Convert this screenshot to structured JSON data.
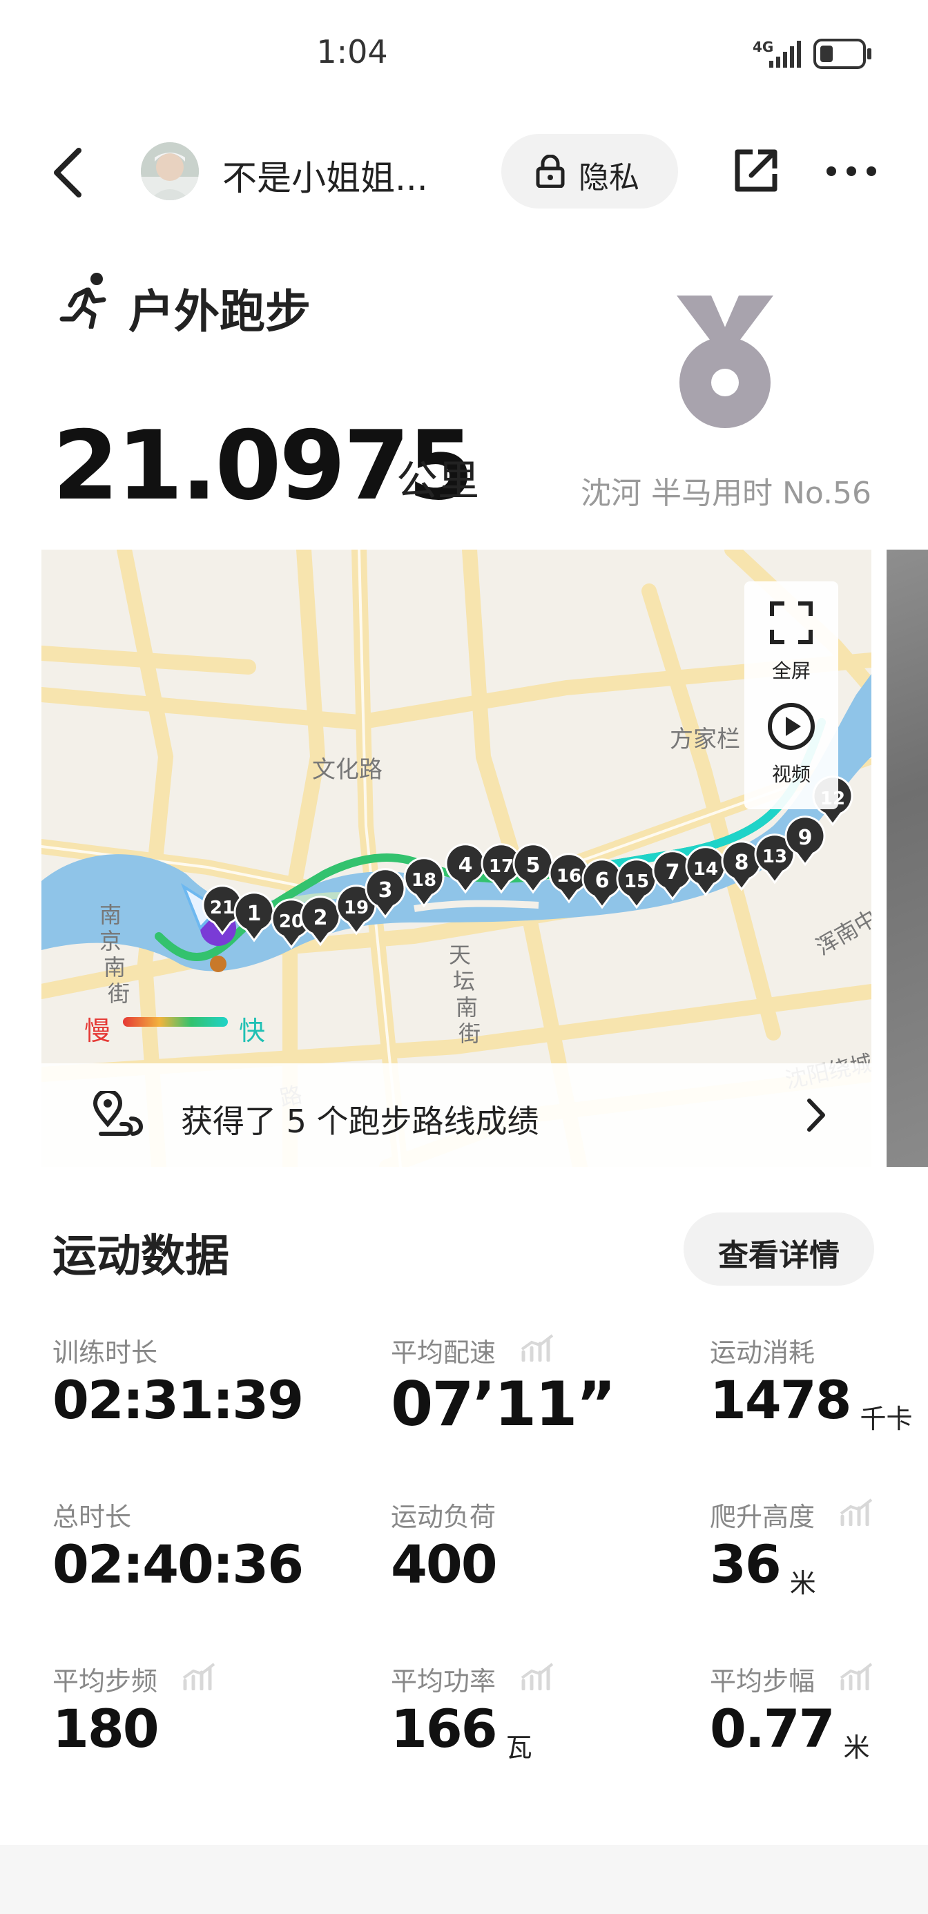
{
  "status_bar": {
    "time": "1:04",
    "network": "4G"
  },
  "header": {
    "nickname": "不是小姐姐...",
    "privacy_label": "隐私"
  },
  "activity": {
    "title": "户外跑步",
    "distance": "21.0975",
    "distance_unit": "公里",
    "medal_label": "沈河 半马用时 No.56"
  },
  "map": {
    "fullscreen_label": "全屏",
    "video_label": "视频",
    "pace_slow": "慢",
    "pace_fast": "快",
    "street_labels": [
      "文化路",
      "方家栏",
      "南京南街",
      "天坛南街",
      "浑南中",
      "沈阳绕城",
      "路"
    ],
    "km_markers": [
      "21",
      "1",
      "20",
      "2",
      "19",
      "3",
      "18",
      "4",
      "17",
      "5",
      "16",
      "6",
      "15",
      "7",
      "14",
      "8",
      "13",
      "9",
      "12"
    ],
    "achievement_text": "获得了 5 个跑步路线成绩"
  },
  "stats": {
    "title": "运动数据",
    "details_label": "查看详情",
    "items": [
      {
        "label": "训练时长",
        "value": "02:31:39",
        "unit": ""
      },
      {
        "label": "平均配速",
        "value": "07’11”",
        "unit": ""
      },
      {
        "label": "运动消耗",
        "value": "1478",
        "unit": "千卡"
      },
      {
        "label": "总时长",
        "value": "02:40:36",
        "unit": ""
      },
      {
        "label": "运动负荷",
        "value": "400",
        "unit": ""
      },
      {
        "label": "爬升高度",
        "value": "36",
        "unit": "米"
      },
      {
        "label": "平均步频",
        "value": "180",
        "unit": ""
      },
      {
        "label": "平均功率",
        "value": "166",
        "unit": "瓦"
      },
      {
        "label": "平均步幅",
        "value": "0.77",
        "unit": "米"
      }
    ]
  },
  "colors": {
    "route_start": "#33c26e",
    "route_end": "#1fd3c8",
    "river": "#8fc4e8",
    "road": "#f7e4ae",
    "medal": "#a8a3ad"
  }
}
